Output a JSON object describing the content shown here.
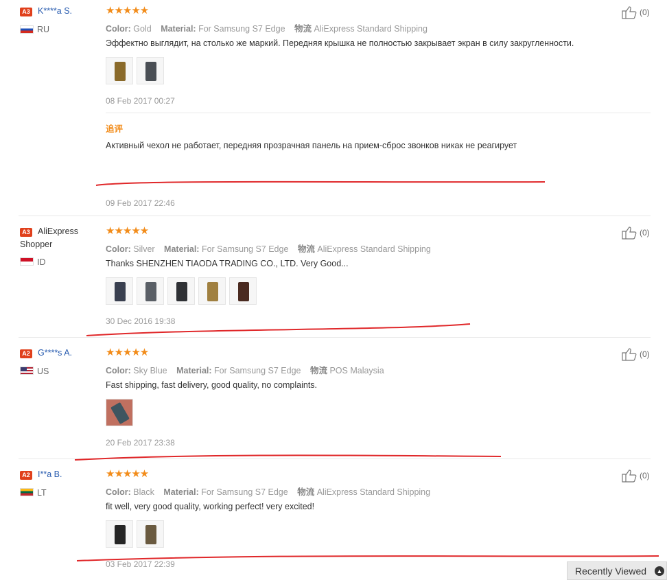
{
  "reviews": [
    {
      "badge": "A3",
      "user": "K****a S.",
      "country": "RU",
      "meta": {
        "color_label": "Color:",
        "color": "Gold",
        "material_label": "Material:",
        "material": "For Samsung S7 Edge",
        "ship_label": "物流",
        "ship": "AliExpress Standard Shipping"
      },
      "text": "Эффектно выглядит, на столько же маркий. Передняя крышка не полностью закрывает экран в силу закругленности.",
      "date": "08 Feb 2017 00:27",
      "likes": "(0)",
      "additional": {
        "label": "追评",
        "text": "Активный чехол не работает, передняя прозрачная панель на прием-сброс звонков никак не реагирует",
        "date": "09 Feb 2017 22:46"
      }
    },
    {
      "badge": "A3",
      "user": "AliExpress Shopper",
      "country": "ID",
      "meta": {
        "color_label": "Color:",
        "color": "Silver",
        "material_label": "Material:",
        "material": "For Samsung S7 Edge",
        "ship_label": "物流",
        "ship": "AliExpress Standard Shipping"
      },
      "text": "Thanks SHENZHEN TIAODA TRADING CO., LTD. Very Good...",
      "date": "30 Dec 2016 19:38",
      "likes": "(0)"
    },
    {
      "badge": "A2",
      "user": "G****s A.",
      "country": "US",
      "meta": {
        "color_label": "Color:",
        "color": "Sky Blue",
        "material_label": "Material:",
        "material": "For Samsung S7 Edge",
        "ship_label": "物流",
        "ship": "POS Malaysia"
      },
      "text": "Fast shipping, fast delivery, good quality, no complaints.",
      "date": "20 Feb 2017 23:38",
      "likes": "(0)"
    },
    {
      "badge": "A2",
      "user": "I**a B.",
      "country": "LT",
      "meta": {
        "color_label": "Color:",
        "color": "Black",
        "material_label": "Material:",
        "material": "For Samsung S7 Edge",
        "ship_label": "物流",
        "ship": "AliExpress Standard Shipping"
      },
      "text": "fit well, very good quality, working perfect! very excited!",
      "date": "03 Feb 2017 22:39",
      "likes": "(0)"
    }
  ],
  "stars": "★★★★★",
  "recently_viewed": "Recently Viewed",
  "colors": {
    "accent": "#f28c1a",
    "badge": "#e0401c",
    "annotation": "#e0282a"
  }
}
